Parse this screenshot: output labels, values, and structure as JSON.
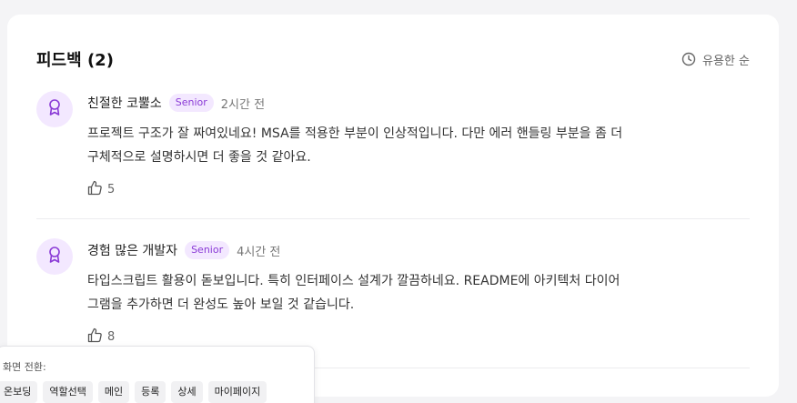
{
  "feedback": {
    "title": "피드백 (2)",
    "sort_label": "유용한 순",
    "items": [
      {
        "name": "친절한 코뿔소",
        "badge": "Senior",
        "time": "2시간 전",
        "text_line1": "프로젝트 구조가 잘 짜여있네요! MSA를 적용한 부분이 인상적입니다. 다만 에러 핸들링 부분을 좀 더",
        "text_line2": "구체적으로 설명하시면 더 좋을 것 같아요.",
        "likes": "5"
      },
      {
        "name": "경험 많은 개발자",
        "badge": "Senior",
        "time": "4시간 전",
        "text_line1": "타입스크립트 활용이 돋보입니다. 특히 인터페이스 설계가 깔끔하네요. README에 아키텍처 다이어",
        "text_line2": "그램을 추가하면 더 완성도 높아 보일 것 같습니다.",
        "likes": "8"
      }
    ]
  },
  "screen_switcher": {
    "label": "화면 전환:",
    "buttons": [
      "온보딩",
      "역할선택",
      "메인",
      "등록",
      "상세",
      "마이페이지"
    ]
  },
  "colors": {
    "accent": "#8a3ad6",
    "accent_bg": "#f3e8ff"
  },
  "icons": {
    "sort": "clock-icon",
    "avatar": "award-icon",
    "likes": "thumbs-up-icon"
  }
}
